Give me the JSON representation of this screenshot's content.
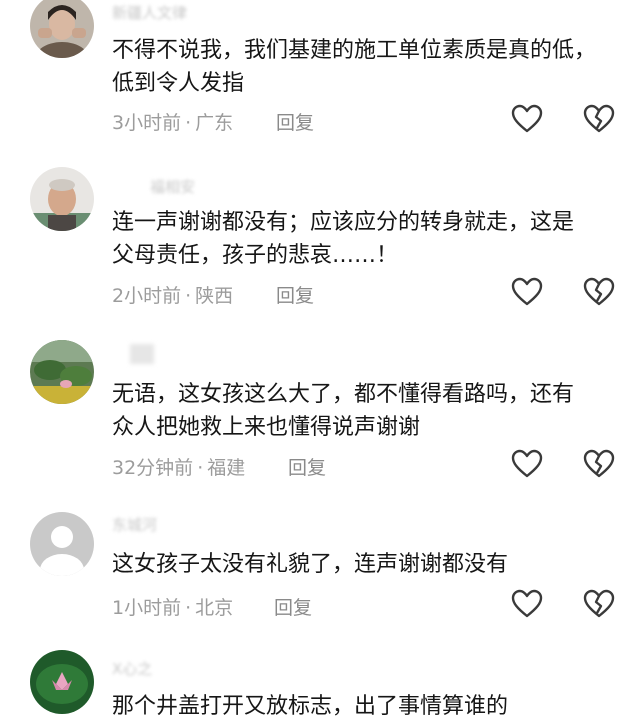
{
  "comments": [
    {
      "username": "新疆人文律",
      "text_lines": [
        "不得不说我，我们基建的施工单位素质是真的低，",
        "低到令人发指"
      ],
      "time": "3小时前",
      "location": "广东",
      "reply_label": "回复",
      "avatar_icon": "portrait-photo"
    },
    {
      "username": "福相安",
      "text_lines": [
        "连一声谢谢都没有；应该应分的转身就走，这是",
        "父母责任，孩子的悲哀……！"
      ],
      "time": "2小时前",
      "location": "陕西",
      "reply_label": "回复",
      "avatar_icon": "portrait-photo"
    },
    {
      "username": "",
      "text_lines": [
        "无语，这女孩这么大了，都不懂得看路吗，还有",
        "众人把她救上来也懂得说声谢谢"
      ],
      "time": "32分钟前",
      "location": "福建",
      "reply_label": "回复",
      "avatar_icon": "lotus-pond-photo"
    },
    {
      "username": "东城河",
      "text_lines": [
        "这女孩子太没有礼貌了，连声谢谢都没有"
      ],
      "time": "1小时前",
      "location": "北京",
      "reply_label": "回复",
      "avatar_icon": "default-user-avatar"
    },
    {
      "username": "X心之",
      "text_lines": [
        "那个井盖打开又放标志，出了事情算谁的"
      ],
      "time": "",
      "location": "",
      "reply_label": "",
      "avatar_icon": "lotus-flower-photo"
    }
  ],
  "icons": {
    "like": "heart-outline-icon",
    "dislike": "broken-heart-outline-icon"
  },
  "colors": {
    "text": "#161616",
    "meta": "#9c9c9c",
    "icon_stroke": "#3a3a3a"
  }
}
